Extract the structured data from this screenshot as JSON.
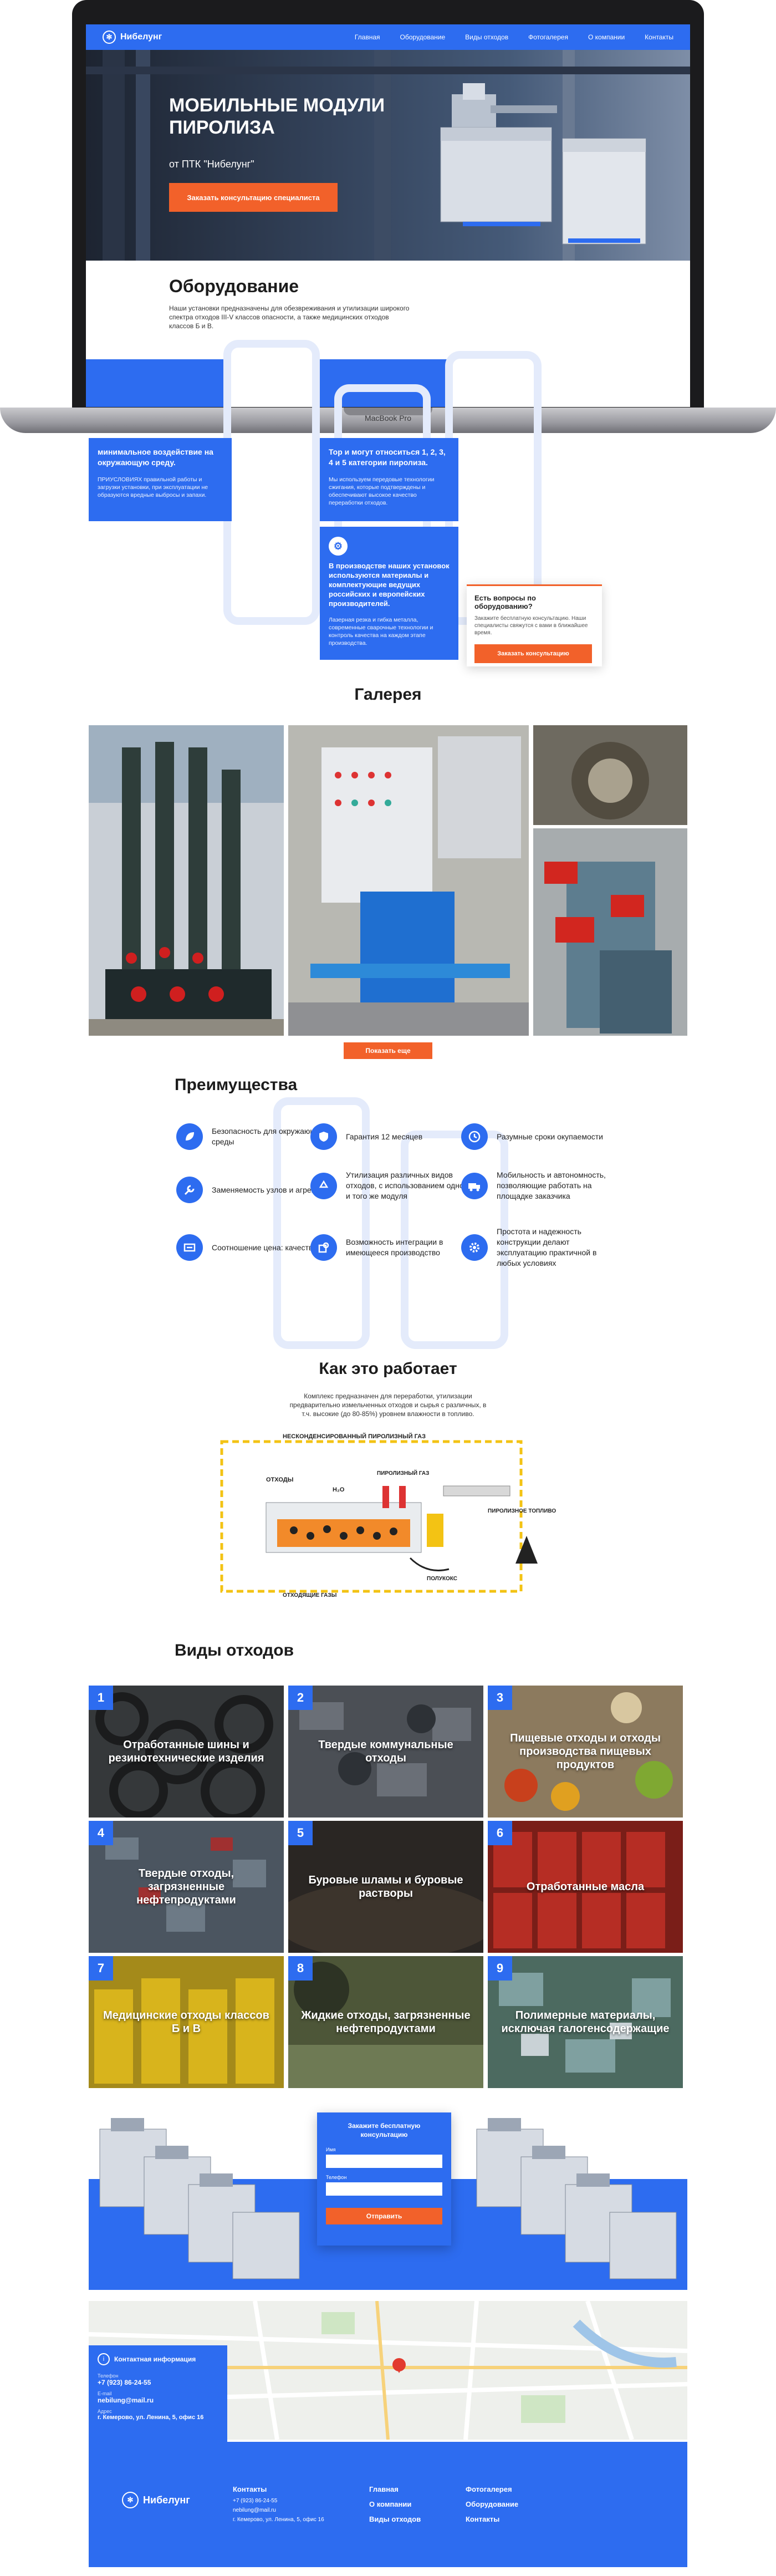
{
  "brand": {
    "name": "Нибелунг",
    "accent": "#2d6cf0",
    "orange": "#f2612a"
  },
  "nav": {
    "items": [
      "Главная",
      "Оборудование",
      "Виды отходов",
      "Фотогалерея",
      "О компании",
      "Контакты"
    ]
  },
  "hero": {
    "title": "МОБИЛЬНЫЕ МОДУЛИ ПИРОЛИЗА",
    "subtitle": "от ПТК \"Нибелунг\"",
    "cta": "Заказать консультацию специалиста"
  },
  "device": {
    "label": "MacBook Pro"
  },
  "equipment": {
    "title": "Оборудование",
    "intro": "Наши установки предназначены для обезвреживания и утилизации широкого спектра отходов III-V классов опасности, а также медицинских отходов классов Б и В.",
    "cards": [
      {
        "head": "минимальное воздействие на окружающую среду.",
        "text": "ПРИУСЛОВИЯХ правильной работы и загрузки установки, при эксплуатации не образуются вредные выбросы и запахи."
      },
      {
        "head": "Тор и могут относиться 1, 2, 3, 4 и 5 категории пиролиза.",
        "text": "Мы используем передовые технологии сжигания, которые подтверждены и обеспечивают высокое качество переработки отходов."
      },
      {
        "head": "В производстве наших установок используются материалы и комплектующие ведущих российских и европейских производителей.",
        "text": "Лазерная резка и гибка металла, современные сварочные технологии и контроль качества на каждом этапе производства."
      }
    ],
    "question": {
      "head": "Есть вопросы по оборудованию?",
      "text": "Закажите бесплатную консультацию. Наши специалисты свяжутся с вами в ближайшее время.",
      "cta": "Заказать консультацию"
    }
  },
  "gallery": {
    "title": "Галерея",
    "more": "Показать еще"
  },
  "advantages": {
    "title": "Преимущества",
    "items": [
      {
        "icon": "leaf-icon",
        "text": "Безопасность для окружающей среды"
      },
      {
        "icon": "shield-icon",
        "text": "Гарантия 12 месяцев"
      },
      {
        "icon": "clock-icon",
        "text": "Разумные сроки окупаемости"
      },
      {
        "icon": "wrench-icon",
        "text": "Заменяемость узлов и агрегатов"
      },
      {
        "icon": "recycle-icon",
        "text": "Утилизация различных видов отходов, с использованием одного и того же модуля"
      },
      {
        "icon": "truck-icon",
        "text": "Мобильность и автономность, позволяющие работать на площадке заказчика"
      },
      {
        "icon": "scale-icon",
        "text": "Соотношение цена: качество"
      },
      {
        "icon": "puzzle-icon",
        "text": "Возможность интеграции в имеющееся производство"
      },
      {
        "icon": "gear-icon",
        "text": "Простота и надежность конструкции делают эксплуатацию практичной в любых условиях"
      }
    ]
  },
  "how": {
    "title": "Как это работает",
    "text": "Комплекс предназначен для переработки, утилизации предварительно измельченных отходов и сырья с различных, в т.ч. высокие (до 80-85%) уровнем влажности в топливо.",
    "diagram_labels": [
      "НЕСКОНДЕНСИРОВАННЫЙ ПИРОЛИЗНЫЙ ГАЗ",
      "ОТХОДЫ",
      "H₂O",
      "ПИРОЛИЗНЫЙ ГАЗ",
      "ПИРОЛИЗНОЕ ТОПЛИВО",
      "ОТХОДЯЩИЕ ГАЗЫ",
      "ПОЛУКОКС"
    ]
  },
  "waste": {
    "title": "Виды отходов",
    "tiles": [
      {
        "num": "1",
        "label": "Отработанные шины и резинотехнические изделия"
      },
      {
        "num": "2",
        "label": "Твердые коммунальные отходы"
      },
      {
        "num": "3",
        "label": "Пищевые отходы и отходы производства пищевых продуктов"
      },
      {
        "num": "4",
        "label": "Твердые отходы, загрязненные нефтепродуктами"
      },
      {
        "num": "5",
        "label": "Буровые шламы и буровые растворы"
      },
      {
        "num": "6",
        "label": "Отработанные масла"
      },
      {
        "num": "7",
        "label": "Медицинские отходы классов Б и В"
      },
      {
        "num": "8",
        "label": "Жидкие отходы, загрязненные нефтепродуктами"
      },
      {
        "num": "9",
        "label": "Полимерные материалы, исключая галогенсодержащие"
      }
    ]
  },
  "form": {
    "title": "Закажите бесплатную консультацию",
    "name_label": "Имя",
    "phone_label": "Телефон",
    "submit": "Отправить"
  },
  "contacts": {
    "title": "Контактная информация",
    "phone_label": "Телефон",
    "phone": "+7 (923) 86-24-55",
    "email_label": "E-mail",
    "email": "nebilung@mail.ru",
    "address_label": "Адрес",
    "address": "г. Кемерово, ул. Ленина, 5, офис 16"
  },
  "footer": {
    "col1_title": "Контакты",
    "col1": [
      "+7 (923) 86-24-55",
      "nebilung@mail.ru",
      "г. Кемерово, ул. Ленина, 5, офис 16"
    ],
    "col2": [
      "Главная",
      "О компании",
      "Виды отходов"
    ],
    "col3": [
      "Фотогалерея",
      "Оборудование",
      "Контакты"
    ]
  }
}
